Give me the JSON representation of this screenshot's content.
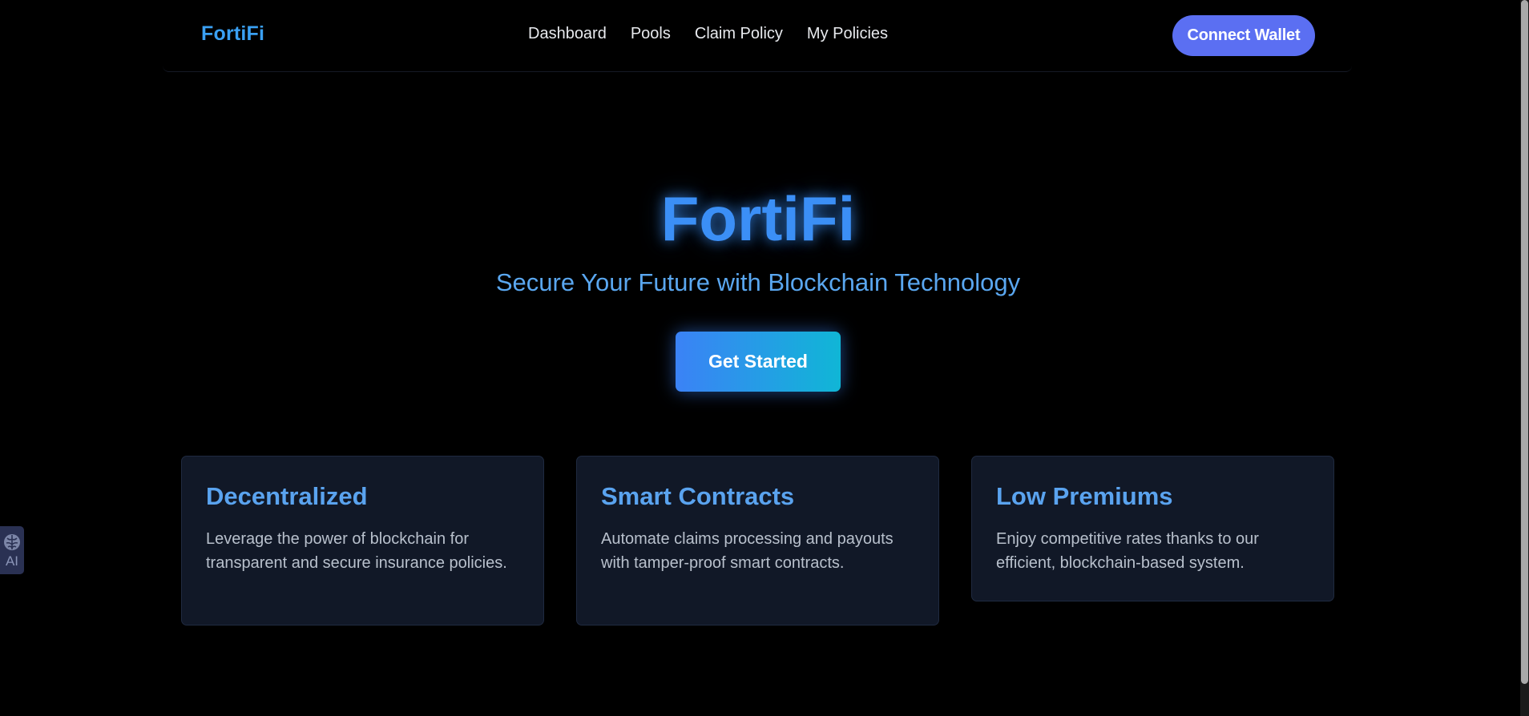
{
  "navbar": {
    "brand": "FortiFi",
    "links": [
      "Dashboard",
      "Pools",
      "Claim Policy",
      "My Policies"
    ],
    "connect_wallet": "Connect Wallet"
  },
  "hero": {
    "title": "FortiFi",
    "subtitle": "Secure Your Future with Blockchain Technology",
    "cta": "Get Started"
  },
  "features": [
    {
      "title": "Decentralized",
      "description": "Leverage the power of blockchain for transparent and secure insurance policies."
    },
    {
      "title": "Smart Contracts",
      "description": "Automate claims processing and payouts with tamper-proof smart contracts."
    },
    {
      "title": "Low Premiums",
      "description": "Enjoy competitive rates thanks to our efficient, blockchain-based system."
    }
  ],
  "ai_widget": {
    "label": "AI",
    "icon": "brain-icon"
  },
  "colors": {
    "background": "#000000",
    "brand": "#3aa0f3",
    "accent": "#5b6ff2",
    "card_bg": "#111827",
    "gradient_start": "#3b82f6",
    "gradient_end": "#10b6d6"
  }
}
